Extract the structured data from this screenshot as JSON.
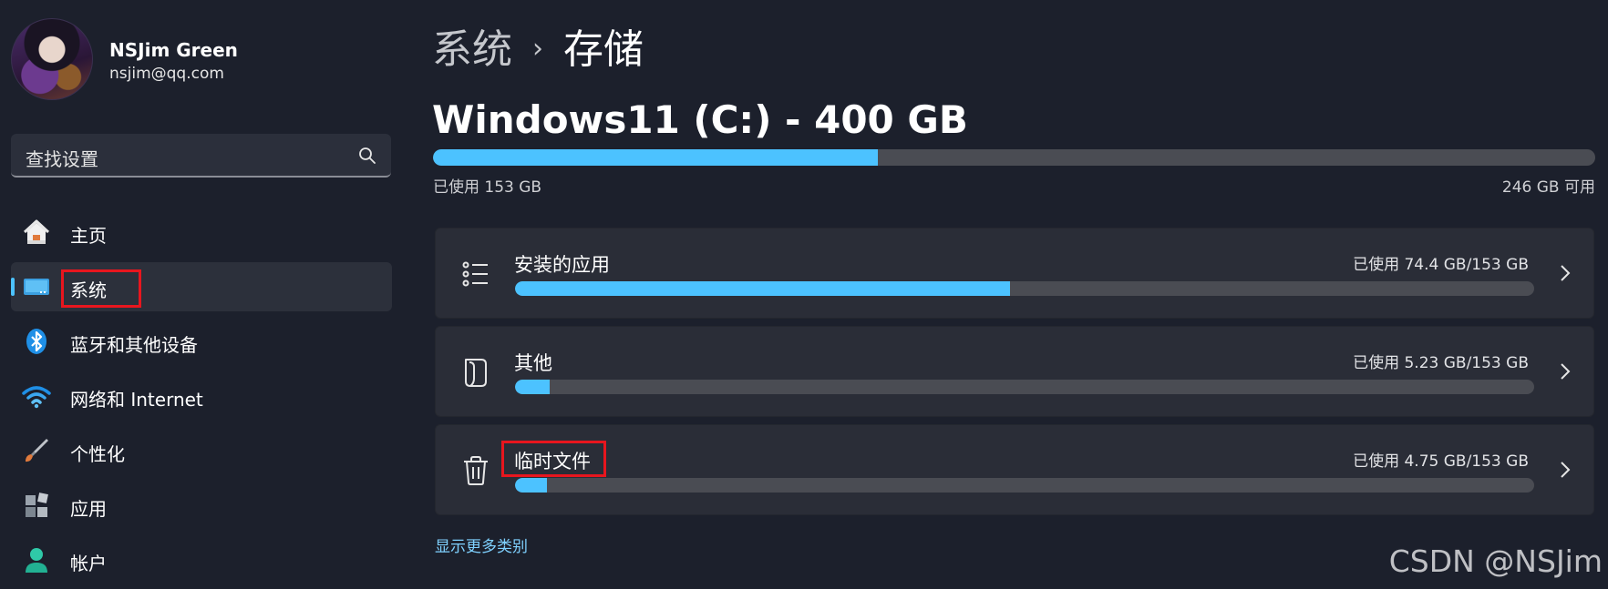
{
  "user": {
    "name": "NSJim Green",
    "email": "nsjim@qq.com"
  },
  "search": {
    "placeholder": "查找设置"
  },
  "nav": {
    "items": [
      {
        "label": "主页",
        "icon": "home-icon"
      },
      {
        "label": "系统",
        "icon": "system-display-icon",
        "selected": true
      },
      {
        "label": "蓝牙和其他设备",
        "icon": "bluetooth-icon"
      },
      {
        "label": "网络和 Internet",
        "icon": "wifi-icon"
      },
      {
        "label": "个性化",
        "icon": "brush-icon"
      },
      {
        "label": "应用",
        "icon": "apps-icon"
      },
      {
        "label": "帐户",
        "icon": "account-icon"
      }
    ]
  },
  "breadcrumb": {
    "parent": "系统",
    "separator": "›",
    "current": "存储"
  },
  "drive": {
    "title": "Windows11 (C:) - 400 GB",
    "used_text": "已使用 153 GB",
    "free_text": "246 GB 可用",
    "used_fraction": 0.383
  },
  "categories": [
    {
      "title": "安装的应用",
      "usage": "已使用 74.4 GB/153 GB",
      "fraction": 0.486,
      "icon": "list-icon"
    },
    {
      "title": "其他",
      "usage": "已使用 5.23 GB/153 GB",
      "fraction": 0.034,
      "icon": "document-icon"
    },
    {
      "title": "临时文件",
      "usage": "已使用 4.75 GB/153 GB",
      "fraction": 0.031,
      "icon": "trash-icon"
    }
  ],
  "more_link": "显示更多类别",
  "watermark": "CSDN @NSJim",
  "colors": {
    "accent": "#4cc2ff",
    "highlight": "#e8161e",
    "background": "#1c202c",
    "card": "#2a2d37"
  }
}
